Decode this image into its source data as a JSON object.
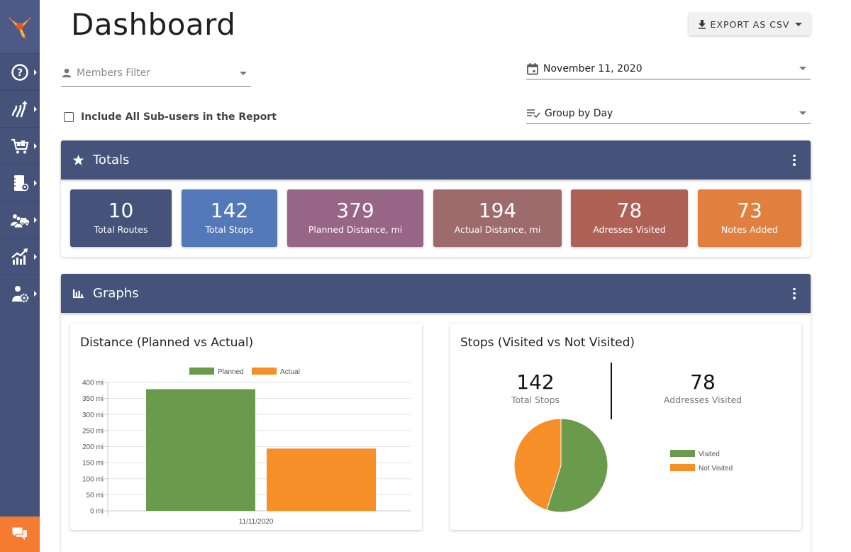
{
  "page": {
    "title": "Dashboard"
  },
  "sidebar": {
    "items": [
      {
        "icon": "help-icon",
        "label": "Help"
      },
      {
        "icon": "routes-icon",
        "label": "Routes"
      },
      {
        "icon": "orders-cart-icon",
        "label": "Orders"
      },
      {
        "icon": "address-book-icon",
        "label": "Address Book"
      },
      {
        "icon": "team-vehicles-icon",
        "label": "Team & Vehicles"
      },
      {
        "icon": "reports-icon",
        "label": "Reports"
      },
      {
        "icon": "user-settings-icon",
        "label": "Settings"
      }
    ],
    "chat_icon": "chat-icon"
  },
  "toolbar": {
    "export_label": "EXPORT AS CSV"
  },
  "filters": {
    "members_placeholder": "Members Filter",
    "include_subusers_label": "Include All Sub-users in the Report",
    "include_subusers_checked": false,
    "date_value": "November 11, 2020",
    "group_by_value": "Group by Day"
  },
  "totals": {
    "title": "Totals",
    "tiles": [
      {
        "value": "10",
        "label": "Total Routes",
        "color": "#45537a"
      },
      {
        "value": "142",
        "label": "Total Stops",
        "color": "#5379bb"
      },
      {
        "value": "379",
        "label": "Planned Distance, mi",
        "color": "#976686"
      },
      {
        "value": "194",
        "label": "Actual Distance, mi",
        "color": "#9d6b6c"
      },
      {
        "value": "78",
        "label": "Adresses Visited",
        "color": "#b06156"
      },
      {
        "value": "73",
        "label": "Notes Added",
        "color": "#e17f3f"
      }
    ]
  },
  "graphs": {
    "title": "Graphs",
    "distance_card": {
      "title": "Distance (Planned vs Actual)"
    },
    "stops_card": {
      "title": "Stops (Visited vs Not Visited)",
      "total_stops_value": "142",
      "total_stops_label": "Total Stops",
      "addresses_visited_value": "78",
      "addresses_visited_label": "Addresses Visited"
    }
  },
  "chart_data": [
    {
      "type": "bar",
      "title": "Distance (Planned vs Actual)",
      "categories": [
        "11/11/2020"
      ],
      "series": [
        {
          "name": "Planned",
          "values": [
            379
          ],
          "color": "#6a9a4b"
        },
        {
          "name": "Actual",
          "values": [
            194
          ],
          "color": "#f78f28"
        }
      ],
      "xlabel": "",
      "ylabel": "",
      "ylim": [
        0,
        400
      ],
      "yticks": [
        0,
        50,
        100,
        150,
        200,
        250,
        300,
        350,
        400
      ],
      "ytick_suffix": " mi",
      "grid": true,
      "legend": "top-center"
    },
    {
      "type": "pie",
      "title": "Stops (Visited vs Not Visited)",
      "slices": [
        {
          "name": "Visited",
          "value": 78,
          "color": "#6a9a4b"
        },
        {
          "name": "Not Visited",
          "value": 64,
          "color": "#f78f28"
        }
      ],
      "legend": "right"
    }
  ]
}
